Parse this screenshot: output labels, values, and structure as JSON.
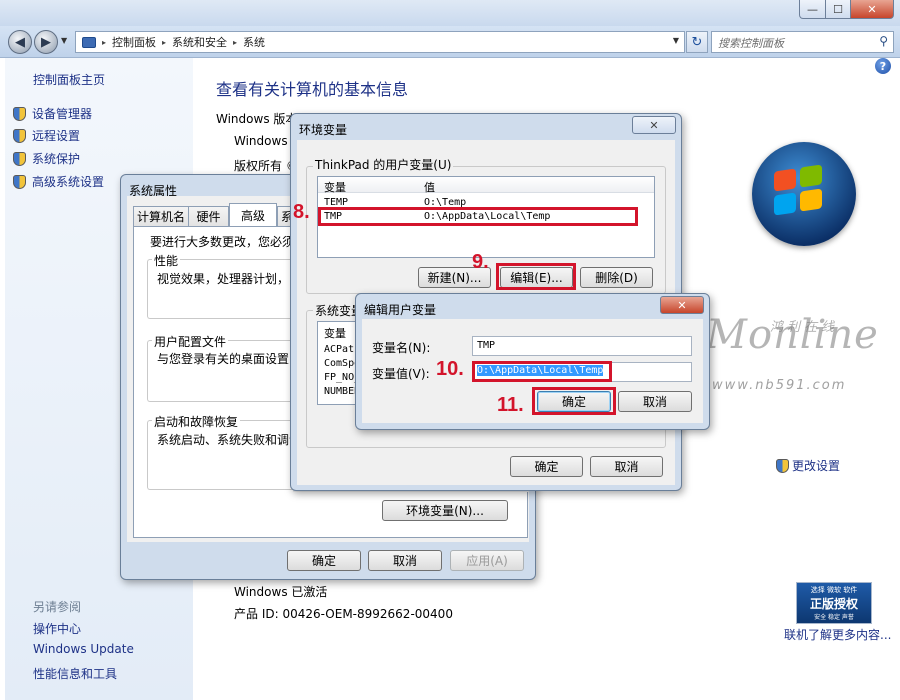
{
  "window": {
    "min": "—",
    "max": "☐",
    "close": "✕"
  },
  "nav": {
    "back": "◀",
    "forward": "▶",
    "breadcrumb": [
      "控制面板",
      "系统和安全",
      "系统"
    ],
    "search_placeholder": "搜索控制面板",
    "sep": "▸",
    "dropdown": "▼",
    "refresh": "↻",
    "search_icon": "⚲"
  },
  "sidebar": {
    "home": "控制面板主页",
    "items": [
      "设备管理器",
      "远程设置",
      "系统保护",
      "高级系统设置"
    ],
    "see_also": "另请参阅",
    "links": [
      "操作中心",
      "Windows Update",
      "性能信息和工具"
    ]
  },
  "content": {
    "title": "查看有关计算机的基本信息",
    "help": "?",
    "edition_heading": "Windows 版本",
    "edition_name": "Windows 7",
    "copyright": "版权所有 ©",
    "change_settings": "更改设置",
    "activated": "Windows 已激活",
    "product_id": "产品 ID: 00426-OEM-8992662-00400",
    "genuine": {
      "top": "选择 微软 软件",
      "mid": "正版授权",
      "bot": "安全 稳定 声誉"
    },
    "learn_more": "联机了解更多内容..."
  },
  "sysprops": {
    "title": "系统属性",
    "tabs": [
      "计算机名",
      "硬件",
      "高级",
      "系"
    ],
    "admin_note": "要进行大多数更改，您必须作",
    "perf_label": "性能",
    "perf_desc": "视觉效果，处理器计划，内",
    "profile_label": "用户配置文件",
    "profile_desc": "与您登录有关的桌面设置",
    "startup_label": "启动和故障恢复",
    "startup_desc": "系统启动、系统失败和调试",
    "env_button": "环境变量(N)...",
    "ok": "确定",
    "cancel": "取消",
    "apply": "应用(A)"
  },
  "envvars": {
    "title": "环境变量",
    "close": "✕",
    "user_label": "ThinkPad 的用户变量(U)",
    "col_var": "变量",
    "col_val": "值",
    "user_rows": [
      {
        "name": "TEMP",
        "value": "O:\\Temp"
      },
      {
        "name": "TMP",
        "value": "O:\\AppData\\Local\\Temp"
      }
    ],
    "new": "新建(N)...",
    "edit": "编辑(E)...",
    "delete": "删除(D)",
    "sys_label": "系统变量",
    "sys_col_var": "变量",
    "sys_rows": [
      "ACPath",
      "ComSpec",
      "FP_NO_",
      "NUMBER"
    ],
    "ok": "确定",
    "cancel": "取消"
  },
  "editvar": {
    "title": "编辑用户变量",
    "close": "✕",
    "name_label": "变量名(N):",
    "name_value": "TMP",
    "value_label": "变量值(V):",
    "value_value": "O:\\AppData\\Local\\Temp",
    "ok": "确定",
    "cancel": "取消"
  },
  "steps": {
    "s8": "8.",
    "s9": "9.",
    "s10": "10.",
    "s11": "11."
  },
  "watermark": {
    "main": "Monline",
    "cn": "鸿利在线",
    "url": "www.nb591.com"
  },
  "colors": {
    "annotation_red": "#d3142b",
    "link_blue": "#1e3287",
    "selection_blue": "#3399ff"
  }
}
